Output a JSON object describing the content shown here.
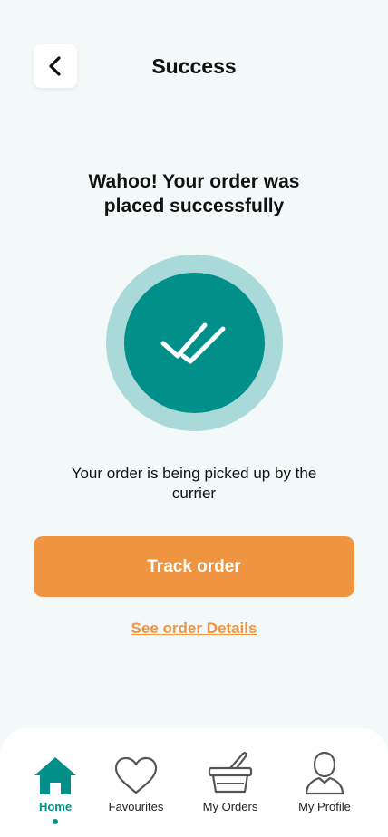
{
  "header": {
    "title": "Success"
  },
  "main": {
    "headline": "Wahoo! Your order was placed successfully",
    "status_text": "Your order is being picked up by the currier",
    "track_button_label": "Track order",
    "details_link_label": "See order Details"
  },
  "bottom_nav": {
    "items": [
      {
        "label": "Home",
        "icon": "home-icon",
        "active": true
      },
      {
        "label": "Favourites",
        "icon": "heart-icon",
        "active": false
      },
      {
        "label": "My Orders",
        "icon": "basket-icon",
        "active": false
      },
      {
        "label": "My Profile",
        "icon": "user-icon",
        "active": false
      }
    ]
  },
  "colors": {
    "background": "#f3f9f9",
    "teal": "#008f89",
    "teal_light": "#a9dad9",
    "orange": "#ef9542"
  }
}
